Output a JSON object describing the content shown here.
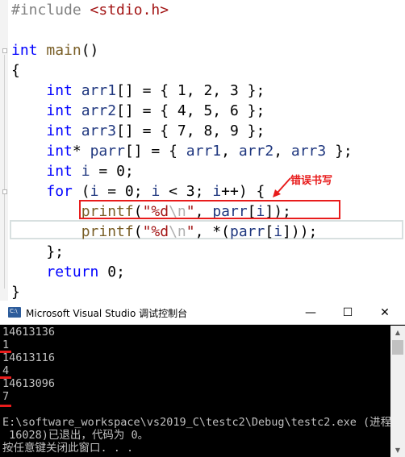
{
  "editor": {
    "lines": [
      {
        "tokens": [
          {
            "t": "#include ",
            "c": "pp"
          },
          {
            "t": "<stdio.h>",
            "c": "str"
          }
        ]
      },
      {
        "tokens": []
      },
      {
        "tokens": [
          {
            "t": "int",
            "c": "kw"
          },
          {
            "t": " ",
            "c": ""
          },
          {
            "t": "main",
            "c": "fn"
          },
          {
            "t": "()",
            "c": ""
          }
        ]
      },
      {
        "tokens": [
          {
            "t": "{",
            "c": ""
          }
        ]
      },
      {
        "tokens": [
          {
            "t": "    ",
            "c": ""
          },
          {
            "t": "int",
            "c": "kw"
          },
          {
            "t": " ",
            "c": ""
          },
          {
            "t": "arr1",
            "c": "id"
          },
          {
            "t": "[] = { 1, 2, 3 };",
            "c": ""
          }
        ]
      },
      {
        "tokens": [
          {
            "t": "    ",
            "c": ""
          },
          {
            "t": "int",
            "c": "kw"
          },
          {
            "t": " ",
            "c": ""
          },
          {
            "t": "arr2",
            "c": "id"
          },
          {
            "t": "[] = { 4, 5, 6 };",
            "c": ""
          }
        ]
      },
      {
        "tokens": [
          {
            "t": "    ",
            "c": ""
          },
          {
            "t": "int",
            "c": "kw"
          },
          {
            "t": " ",
            "c": ""
          },
          {
            "t": "arr3",
            "c": "id"
          },
          {
            "t": "[] = { 7, 8, 9 };",
            "c": ""
          }
        ]
      },
      {
        "tokens": [
          {
            "t": "    ",
            "c": ""
          },
          {
            "t": "int",
            "c": "kw"
          },
          {
            "t": "* ",
            "c": ""
          },
          {
            "t": "parr",
            "c": "id"
          },
          {
            "t": "[] = { ",
            "c": ""
          },
          {
            "t": "arr1",
            "c": "id"
          },
          {
            "t": ", ",
            "c": ""
          },
          {
            "t": "arr2",
            "c": "id"
          },
          {
            "t": ", ",
            "c": ""
          },
          {
            "t": "arr3",
            "c": "id"
          },
          {
            "t": " };",
            "c": ""
          }
        ]
      },
      {
        "tokens": [
          {
            "t": "    ",
            "c": ""
          },
          {
            "t": "int",
            "c": "kw"
          },
          {
            "t": " ",
            "c": ""
          },
          {
            "t": "i",
            "c": "id"
          },
          {
            "t": " = 0;",
            "c": ""
          }
        ]
      },
      {
        "tokens": [
          {
            "t": "    ",
            "c": ""
          },
          {
            "t": "for",
            "c": "kw"
          },
          {
            "t": " (",
            "c": ""
          },
          {
            "t": "i",
            "c": "id"
          },
          {
            "t": " = 0; ",
            "c": ""
          },
          {
            "t": "i",
            "c": "id"
          },
          {
            "t": " < 3; ",
            "c": ""
          },
          {
            "t": "i",
            "c": "id"
          },
          {
            "t": "++) {",
            "c": ""
          }
        ]
      },
      {
        "tokens": [
          {
            "t": "        ",
            "c": ""
          },
          {
            "t": "printf",
            "c": "fn"
          },
          {
            "t": "(",
            "c": ""
          },
          {
            "t": "\"%d",
            "c": "str"
          },
          {
            "t": "\\n",
            "c": "esc"
          },
          {
            "t": "\"",
            "c": "str"
          },
          {
            "t": ", ",
            "c": ""
          },
          {
            "t": "parr",
            "c": "id"
          },
          {
            "t": "[",
            "c": ""
          },
          {
            "t": "i",
            "c": "id"
          },
          {
            "t": "]);",
            "c": ""
          }
        ]
      },
      {
        "tokens": [
          {
            "t": "        ",
            "c": ""
          },
          {
            "t": "printf",
            "c": "fn"
          },
          {
            "t": "(",
            "c": ""
          },
          {
            "t": "\"%d",
            "c": "str"
          },
          {
            "t": "\\n",
            "c": "esc"
          },
          {
            "t": "\"",
            "c": "str"
          },
          {
            "t": ", *(",
            "c": ""
          },
          {
            "t": "parr",
            "c": "id"
          },
          {
            "t": "[",
            "c": ""
          },
          {
            "t": "i",
            "c": "id"
          },
          {
            "t": "]));",
            "c": ""
          }
        ]
      },
      {
        "tokens": [
          {
            "t": "    };",
            "c": ""
          }
        ]
      },
      {
        "tokens": [
          {
            "t": "    ",
            "c": ""
          },
          {
            "t": "return",
            "c": "kw"
          },
          {
            "t": " 0;",
            "c": ""
          }
        ]
      },
      {
        "tokens": [
          {
            "t": "}",
            "c": ""
          }
        ]
      }
    ],
    "annotation": "错误书写"
  },
  "console": {
    "title": "Microsoft Visual Studio 调试控制台",
    "icon_text": "C:\\",
    "buttons": {
      "minimize": "—",
      "maximize": "☐",
      "close": "✕"
    },
    "output": [
      "14613136",
      "1",
      "14613116",
      "4",
      "14613096",
      "7",
      "",
      "E:\\software_workspace\\vs2019_C\\testc2\\Debug\\testc2.exe (进程",
      " 16028)已退出，代码为 0。",
      "按任意键关闭此窗口. . ."
    ]
  },
  "colors": {
    "keyword": "#0000ff",
    "function": "#795e26",
    "string": "#a31515",
    "preprocessor": "#808080",
    "annotation": "#e81c1c"
  }
}
